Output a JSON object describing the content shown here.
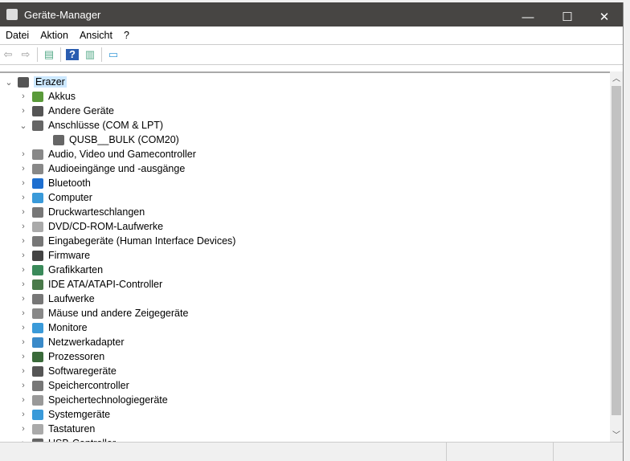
{
  "window": {
    "title": "Geräte-Manager",
    "minimize": "—",
    "maximize": "☐",
    "close": "✕"
  },
  "menu": [
    "Datei",
    "Aktion",
    "Ansicht",
    "?"
  ],
  "toolbar": {
    "back": "⇦",
    "forward": "⇨",
    "properties": "▤",
    "help": "?",
    "update": "▥",
    "scan": "▭"
  },
  "tree": {
    "root": "Erazer",
    "items": [
      {
        "label": "Akkus",
        "color": "#5a9a3a",
        "expanded": false,
        "level": 1
      },
      {
        "label": "Andere Geräte",
        "color": "#555",
        "expanded": false,
        "level": 1
      },
      {
        "label": "Anschlüsse (COM & LPT)",
        "color": "#666",
        "expanded": true,
        "level": 1
      },
      {
        "label": "QUSB__BULK (COM20)",
        "color": "#666",
        "level": 2
      },
      {
        "label": "Audio, Video und Gamecontroller",
        "color": "#888",
        "expanded": false,
        "level": 1
      },
      {
        "label": "Audioeingänge und -ausgänge",
        "color": "#888",
        "expanded": false,
        "level": 1
      },
      {
        "label": "Bluetooth",
        "color": "#1e6fd0",
        "expanded": false,
        "level": 1
      },
      {
        "label": "Computer",
        "color": "#3a9ad9",
        "expanded": false,
        "level": 1
      },
      {
        "label": "Druckwarteschlangen",
        "color": "#777",
        "expanded": false,
        "level": 1
      },
      {
        "label": "DVD/CD-ROM-Laufwerke",
        "color": "#aaa",
        "expanded": false,
        "level": 1
      },
      {
        "label": "Eingabegeräte (Human Interface Devices)",
        "color": "#777",
        "expanded": false,
        "level": 1
      },
      {
        "label": "Firmware",
        "color": "#444",
        "expanded": false,
        "level": 1
      },
      {
        "label": "Grafikkarten",
        "color": "#3a8a5a",
        "expanded": false,
        "level": 1
      },
      {
        "label": "IDE ATA/ATAPI-Controller",
        "color": "#4a7a4a",
        "expanded": false,
        "level": 1
      },
      {
        "label": "Laufwerke",
        "color": "#777",
        "expanded": false,
        "level": 1
      },
      {
        "label": "Mäuse und andere Zeigegeräte",
        "color": "#888",
        "expanded": false,
        "level": 1
      },
      {
        "label": "Monitore",
        "color": "#3a9ad9",
        "expanded": false,
        "level": 1
      },
      {
        "label": "Netzwerkadapter",
        "color": "#3a8ac9",
        "expanded": false,
        "level": 1
      },
      {
        "label": "Prozessoren",
        "color": "#3a6a3a",
        "expanded": false,
        "level": 1
      },
      {
        "label": "Softwaregeräte",
        "color": "#555",
        "expanded": false,
        "level": 1
      },
      {
        "label": "Speichercontroller",
        "color": "#777",
        "expanded": false,
        "level": 1
      },
      {
        "label": "Speichertechnologiegeräte",
        "color": "#999",
        "expanded": false,
        "level": 1
      },
      {
        "label": "Systemgeräte",
        "color": "#3a9ad9",
        "expanded": false,
        "level": 1
      },
      {
        "label": "Tastaturen",
        "color": "#aaa",
        "expanded": false,
        "level": 1
      },
      {
        "label": "USB-Controller",
        "color": "#666",
        "expanded": false,
        "level": 1
      }
    ]
  }
}
